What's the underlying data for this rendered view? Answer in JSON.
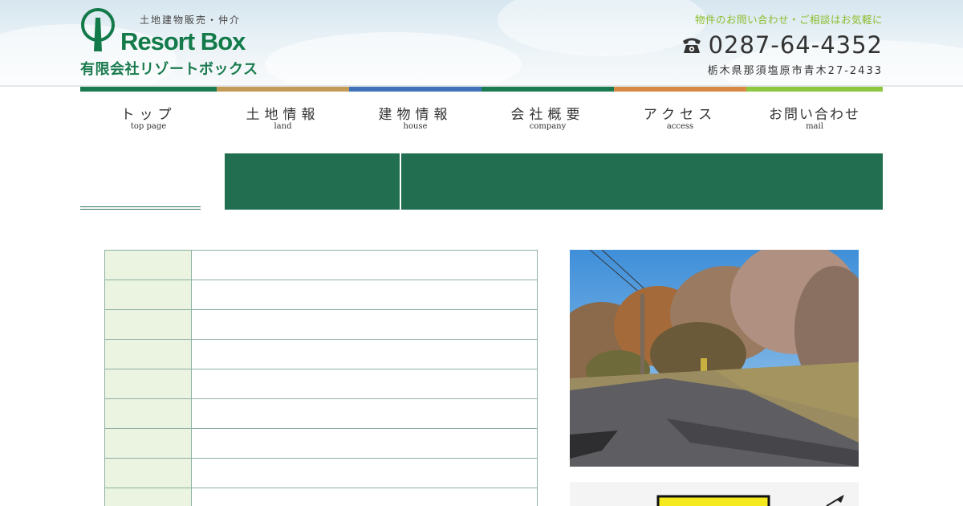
{
  "header": {
    "tagline": "土地建物販売・仲介",
    "brand": "Resort Box",
    "company": "有限会社リゾートボックス",
    "contact_lead": "物件のお問い合わせ・ご相談はお気軽に",
    "phone": "0287-64-4352",
    "address": "栃木県那須塩原市青木27-2433"
  },
  "nav": {
    "items": [
      {
        "jp": "トップ",
        "en": "top page",
        "color": "#1a7a50"
      },
      {
        "jp": "土地情報",
        "en": "land",
        "color": "#c49b56"
      },
      {
        "jp": "建物情報",
        "en": "house",
        "color": "#3f72b8"
      },
      {
        "jp": "会社概要",
        "en": "company",
        "color": "#1a7a50"
      },
      {
        "jp": "アクセス",
        "en": "access",
        "color": "#d88a45"
      },
      {
        "jp": "お問い合わせ",
        "en": "mail",
        "color": "#8ec63f"
      }
    ]
  },
  "colors": {
    "brand_green": "#137a4a",
    "banner_green": "#216e50",
    "table_key_bg": "#eaf4e0",
    "lead_text": "#8bbc2a"
  },
  "icons": {
    "phone": "telephone-icon",
    "logo": "tree-logo-icon"
  }
}
